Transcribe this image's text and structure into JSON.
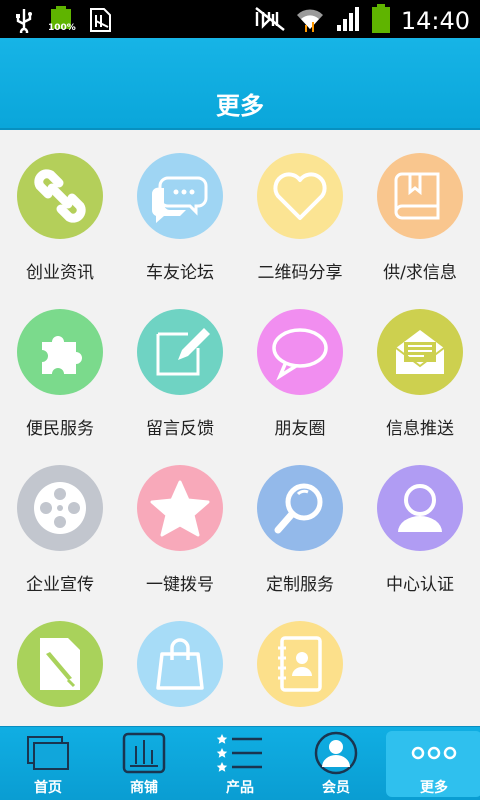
{
  "status_bar": {
    "time": "14:40",
    "battery_level_text": "100%",
    "icons": [
      "usb-icon",
      "battery-full-icon",
      "sd-card-icon",
      "mute-icon",
      "wifi-icon",
      "signal-icon",
      "battery-icon"
    ]
  },
  "header": {
    "title": "更多"
  },
  "grid": {
    "items": [
      {
        "label": "创业资讯",
        "icon": "link-icon",
        "color": "#b4cf5a"
      },
      {
        "label": "车友论坛",
        "icon": "chat-bubbles-icon",
        "color": "#9fd5f3"
      },
      {
        "label": "二维码分享",
        "icon": "heart-icon",
        "color": "#fbe493"
      },
      {
        "label": "供/求信息",
        "icon": "book-icon",
        "color": "#f9c68e"
      },
      {
        "label": "便民服务",
        "icon": "puzzle-icon",
        "color": "#7bda8c"
      },
      {
        "label": "留言反馈",
        "icon": "edit-icon",
        "color": "#6fd3c3"
      },
      {
        "label": "朋友圈",
        "icon": "speech-bubble-icon",
        "color": "#f18ef0"
      },
      {
        "label": "信息推送",
        "icon": "mail-icon",
        "color": "#cdd04f"
      },
      {
        "label": "企业宣传",
        "icon": "film-reel-icon",
        "color": "#c2c6ce"
      },
      {
        "label": "一键拨号",
        "icon": "star-icon",
        "color": "#f8a9ba"
      },
      {
        "label": "定制服务",
        "icon": "magnifier-icon",
        "color": "#93b9ea"
      },
      {
        "label": "中心认证",
        "icon": "user-icon",
        "color": "#b09cf3"
      },
      {
        "label": "",
        "icon": "document-edit-icon",
        "color": "#a9d25b"
      },
      {
        "label": "",
        "icon": "shopping-bag-icon",
        "color": "#a7dcf7"
      },
      {
        "label": "",
        "icon": "contact-book-icon",
        "color": "#fce08b"
      }
    ]
  },
  "bottom_nav": {
    "items": [
      {
        "label": "首页",
        "icon": "home-windows-icon",
        "active": false
      },
      {
        "label": "商铺",
        "icon": "shop-chart-icon",
        "active": false
      },
      {
        "label": "产品",
        "icon": "star-list-icon",
        "active": false
      },
      {
        "label": "会员",
        "icon": "member-avatar-icon",
        "active": false
      },
      {
        "label": "更多",
        "icon": "more-dots-icon",
        "active": true
      }
    ]
  }
}
